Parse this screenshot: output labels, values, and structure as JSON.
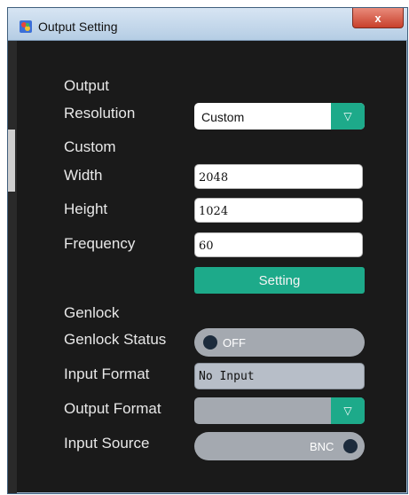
{
  "window": {
    "title": "Output Setting",
    "close_glyph": "x"
  },
  "icons": {
    "app": "app-logo-icon",
    "close": "close-icon",
    "dropdown": "triangle-down-icon"
  },
  "labels": {
    "output": "Output",
    "resolution": "Resolution",
    "custom": "Custom",
    "width": "Width",
    "height": "Height",
    "frequency": "Frequency",
    "genlock": "Genlock",
    "genlock_status": "Genlock Status",
    "input_format": "Input Format",
    "output_format": "Output Format",
    "input_source": "Input Source"
  },
  "fields": {
    "resolution_value": "Custom",
    "dropdown_arrow": "▽",
    "width_value": "2048",
    "height_value": "1024",
    "frequency_value": "60",
    "input_format_value": "No Input",
    "output_format_value": ""
  },
  "buttons": {
    "setting": "Setting"
  },
  "toggles": {
    "genlock_status": {
      "state": "OFF"
    },
    "input_source": {
      "state": "BNC"
    }
  },
  "colors": {
    "accent": "#1daa8a",
    "window_bg": "#1a1a1a",
    "toggle_bg": "#a4a9b0",
    "close_button": "#c8402b"
  }
}
